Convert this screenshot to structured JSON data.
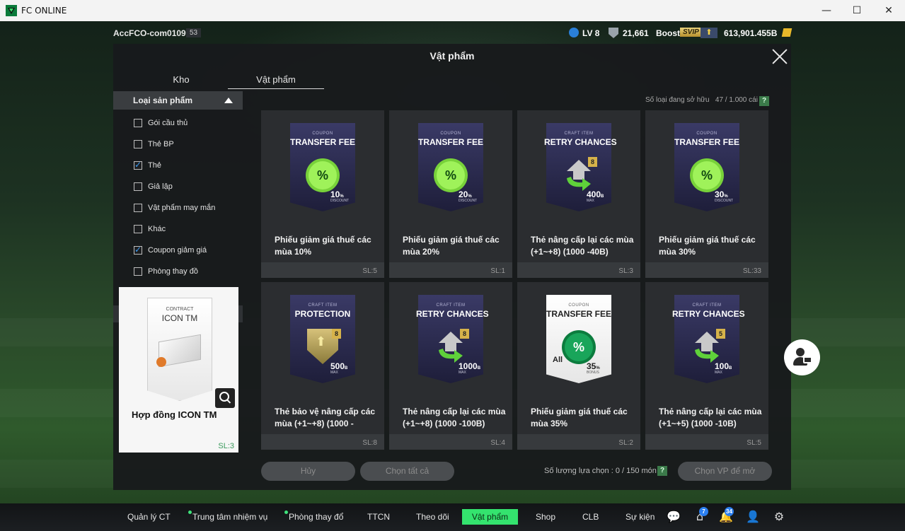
{
  "window": {
    "title": "FC ONLINE",
    "minimize": "—",
    "maximize": "☐",
    "close": "✕"
  },
  "topbar": {
    "account": "AccFCO-com0109c",
    "account_level": "53",
    "lv": "LV 8",
    "points": "21,661",
    "boost": "Boost",
    "svip": "SVIP",
    "up_icon": "⬆",
    "coins": "613,901.455B"
  },
  "modal": {
    "title": "Vật phẩm"
  },
  "tabs": [
    {
      "label": "Kho",
      "active": false
    },
    {
      "label": "Vật phẩm",
      "active": true
    }
  ],
  "filter": {
    "header": "Loại sản phẩm",
    "items": [
      {
        "label": "Gói cầu thủ",
        "checked": false
      },
      {
        "label": "Thẻ BP",
        "checked": false
      },
      {
        "label": "Thẻ",
        "checked": true
      },
      {
        "label": "Giả lập",
        "checked": false
      },
      {
        "label": "Vật phẩm may mắn",
        "checked": false
      },
      {
        "label": "Khác",
        "checked": false
      },
      {
        "label": "Coupon giảm giá",
        "checked": true
      },
      {
        "label": "Phòng thay đồ",
        "checked": false
      }
    ]
  },
  "preview": {
    "card_top": "CONTRACT",
    "card_title": "ICON TM",
    "name": "Hợp đồng ICON TM",
    "qty": "SL:3"
  },
  "owned": {
    "label": "Số loại đang sở hữu",
    "value": "47 / 1.000 cái",
    "help": "?"
  },
  "items": [
    {
      "top": "COUPON",
      "title": "TRANSFER FEE",
      "art": "coupon",
      "value": "10",
      "unit": "%",
      "note": "DISCOUNT",
      "name": "Phiếu giảm giá thuế các mùa 10%",
      "qty": "SL:5"
    },
    {
      "top": "COUPON",
      "title": "TRANSFER FEE",
      "art": "coupon",
      "value": "20",
      "unit": "%",
      "note": "DISCOUNT",
      "name": "Phiếu giảm giá thuế các mùa 20%",
      "qty": "SL:1"
    },
    {
      "top": "CRAFT ITEM",
      "title": "RETRY CHANCES",
      "art": "retry",
      "tier": "8",
      "value": "400",
      "unit": "B",
      "note": "MAX",
      "name": "Thẻ nâng cấp lại các mùa (+1~+8) (1000 -40B)",
      "qty": "SL:3"
    },
    {
      "top": "COUPON",
      "title": "TRANSFER FEE",
      "art": "coupon",
      "value": "30",
      "unit": "%",
      "note": "DISCOUNT",
      "name": "Phiếu giảm giá thuế các mùa 30%",
      "qty": "SL:33"
    },
    {
      "top": "CRAFT ITEM",
      "title": "PROTECTION",
      "art": "shield",
      "tier": "8",
      "value": "500",
      "unit": "B",
      "note": "MAX",
      "name": "Thẻ bảo vệ nâng cấp các mùa (+1~+8) (1000 -",
      "qty": "SL:8"
    },
    {
      "top": "CRAFT ITEM",
      "title": "RETRY CHANCES",
      "art": "retry",
      "tier": "8",
      "value": "1000",
      "unit": "B",
      "note": "MAX",
      "name": "Thẻ nâng cấp lại các mùa (+1~+8) (1000 -100B)",
      "qty": "SL:4"
    },
    {
      "top": "COUPON",
      "title": "TRANSFER FEE",
      "art": "coupon-white",
      "all": "All",
      "value": "35",
      "unit": "%",
      "note": "BONUS",
      "name": "Phiếu giảm giá thuế các mùa 35%",
      "qty": "SL:2"
    },
    {
      "top": "CRAFT ITEM",
      "title": "RETRY CHANCES",
      "art": "retry",
      "tier": "5",
      "value": "100",
      "unit": "B",
      "note": "MAX",
      "name": "Thẻ nâng cấp lại các mùa (+1~+5) (1000 -10B)",
      "qty": "SL:5"
    }
  ],
  "footer": {
    "cancel": "Hủy",
    "select_all": "Chọn tất cả",
    "selected_label": "Số lượng lựa chọn : 0 / 150 món",
    "help": "?",
    "open_button": "Chọn VP để mở"
  },
  "nav": {
    "items": [
      {
        "label": "Quản lý CT",
        "dot": false
      },
      {
        "label": "Trung tâm nhiệm vụ",
        "dot": true
      },
      {
        "label": "Phòng thay đổ",
        "dot": true
      },
      {
        "label": "TTCN",
        "dot": false
      },
      {
        "label": "Theo dõi",
        "dot": false
      },
      {
        "label": "Vật phẩm",
        "dot": false,
        "active": true
      },
      {
        "label": "Shop",
        "dot": false
      },
      {
        "label": "CLB",
        "dot": false
      },
      {
        "label": "Sự kiện",
        "dot": false
      }
    ],
    "badges": {
      "home": "7",
      "bell": "34"
    }
  },
  "colors": {
    "accent": "#34e36e",
    "check": "#3d9cf2",
    "qty_green": "#3a9a5c"
  }
}
